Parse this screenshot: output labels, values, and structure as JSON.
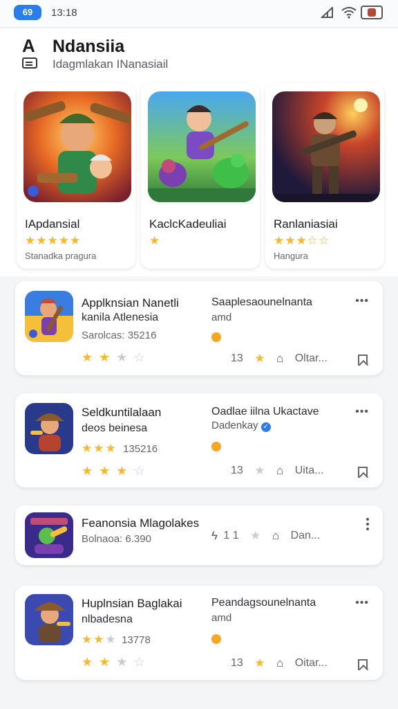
{
  "status": {
    "pill": "69",
    "time": "13:18"
  },
  "header": {
    "logo": "A",
    "title": "Ndansiia",
    "subtitle": "Idagmlakan INanasiail"
  },
  "featured": [
    {
      "name": "IApdansial",
      "stars": "★★★★★",
      "meta": "Stanadka pragura"
    },
    {
      "name": "KaclcKadeuliai",
      "stars": "★",
      "meta": ""
    },
    {
      "name": "Ranlaniasiai",
      "stars": "★★★☆☆",
      "meta": "Hangura"
    }
  ],
  "items": [
    {
      "title": "Applknsian Nanetli",
      "subtitle": "kanila Atlenesia",
      "meta": "Sarolcas: 35216",
      "right_title": "Saaplesaounelnanta",
      "right_sub": "amd",
      "more": "•••",
      "action_count": "13",
      "action_text": "Oltar..."
    },
    {
      "title": "Seldkuntilalaan",
      "subtitle": "deos beinesa",
      "meta": "135216",
      "right_title": "Oadlae iilna Ukactave",
      "right_sub": "Dadenkay",
      "more": "•••",
      "action_count": "13",
      "action_text": "Uita..."
    },
    {
      "title": "Feanonsia Mlagolakes",
      "meta": "Bolnaoa: 6.390",
      "action_count": "1 1",
      "action_text": "Dan..."
    },
    {
      "title": "Huplnsian Baglakai",
      "subtitle": "nlbadesna",
      "meta": "13778",
      "right_title": "Peandagsounelnanta",
      "right_sub": "amd",
      "more": "•••",
      "action_count": "13",
      "action_text": "Oitar..."
    }
  ],
  "colors": {
    "accent": "#2b7de9",
    "star": "#f5b82e",
    "dot": "#f5a623"
  }
}
